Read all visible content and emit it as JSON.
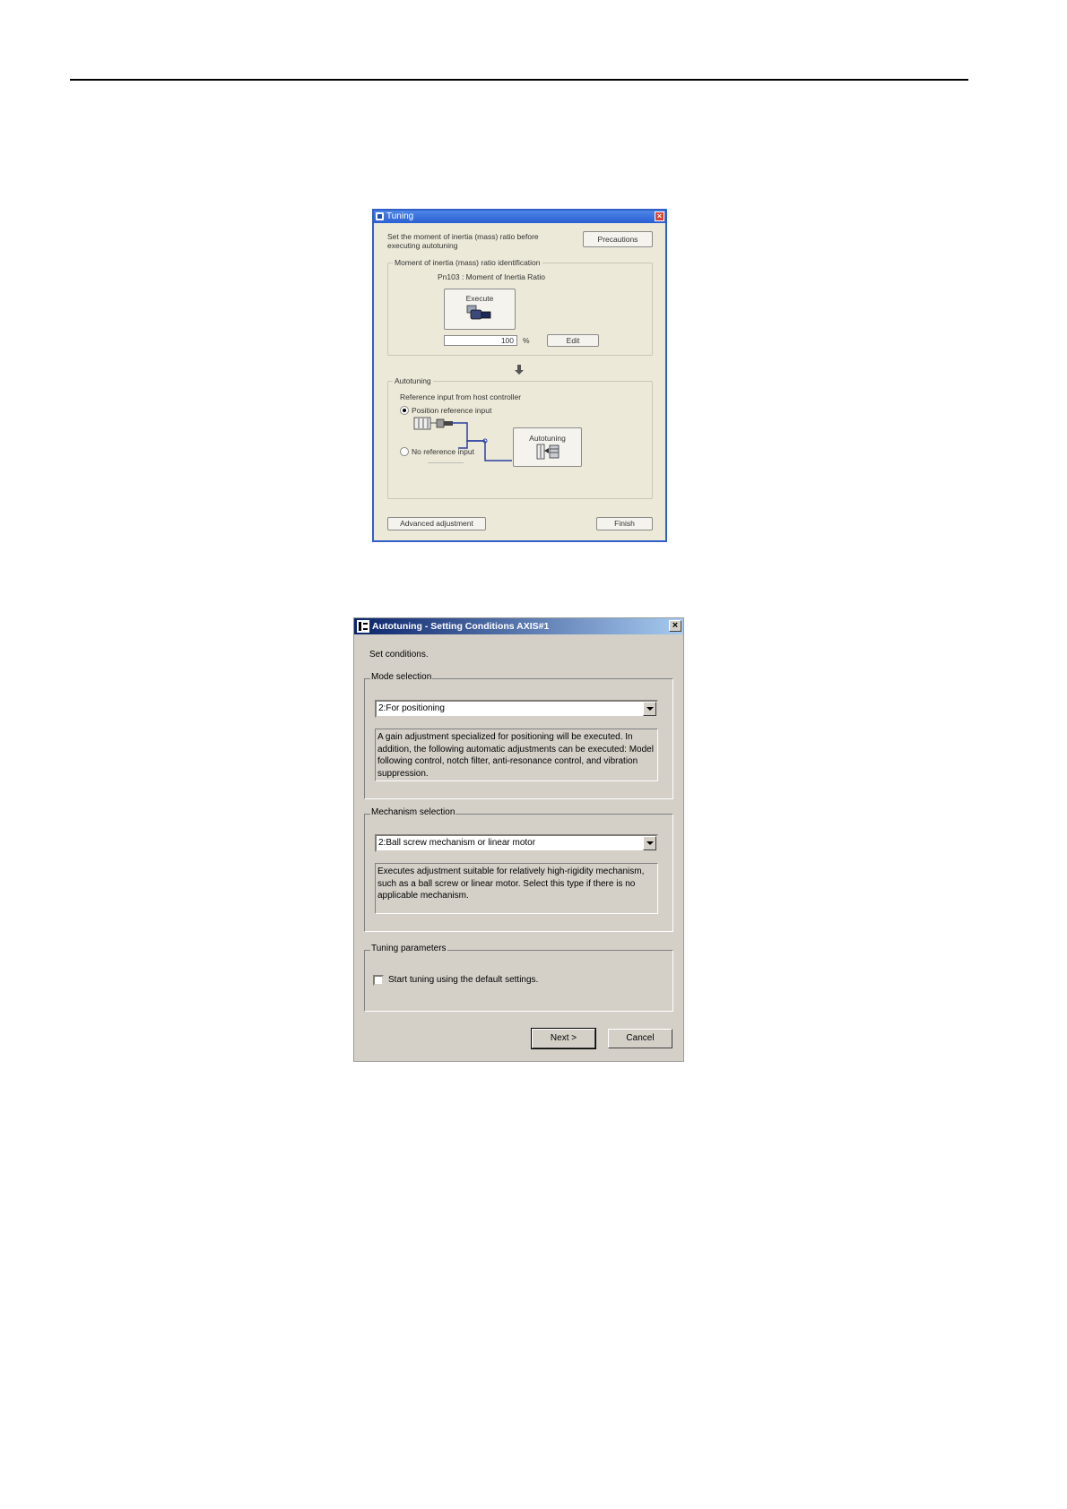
{
  "tuning": {
    "title": "Tuning",
    "instruction": "Set the moment of inertia (mass) ratio before executing autotuning",
    "precautions_label": "Precautions",
    "inertia_group_label": "Moment of inertia (mass) ratio identification",
    "pn_label": "Pn103 : Moment of Inertia Ratio",
    "execute_label": "Execute",
    "inertia_value": "100",
    "inertia_unit": "%",
    "edit_label": "Edit",
    "autotuning_group_label": "Autotuning",
    "reference_label": "Reference input from host controller",
    "option_position": "Position reference input",
    "option_none": "No reference input",
    "autotuning_button_label": "Autotuning",
    "advanced_label": "Advanced adjustment",
    "finish_label": "Finish",
    "colors": {
      "titlebar": "#2a5fd2",
      "diagram_line": "#2b3fa3"
    }
  },
  "setting": {
    "title": "Autotuning - Setting Conditions AXIS#1",
    "prompt": "Set conditions.",
    "mode": {
      "legend": "Mode selection",
      "selected": "2:For positioning",
      "description": "A gain adjustment specialized for positioning will be executed. In addition, the following automatic adjustments can be executed: Model following control, notch filter, anti-resonance control, and vibration suppression."
    },
    "mechanism": {
      "legend": "Mechanism selection",
      "selected": "2:Ball screw mechanism or linear motor",
      "description": "Executes adjustment suitable for relatively high-rigidity mechanism, such as a ball screw or linear motor. Select this type if there is no applicable mechanism."
    },
    "tuning_params": {
      "legend": "Tuning parameters",
      "checkbox_label": "Start tuning using the default settings."
    },
    "next_label": "Next >",
    "cancel_label": "Cancel",
    "colors": {
      "titlebar_start": "#0a246a",
      "titlebar_end": "#a6caf0",
      "face": "#d4d0c8"
    }
  }
}
